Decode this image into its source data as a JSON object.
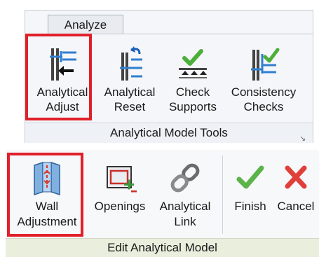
{
  "ribbon": {
    "tab": "Analyze",
    "top_panel": {
      "title": "Analytical Model Tools",
      "tools": [
        {
          "line1": "Analytical",
          "line2": "Adjust",
          "icon": "analytical-adjust-icon"
        },
        {
          "line1": "Analytical",
          "line2": "Reset",
          "icon": "analytical-reset-icon"
        },
        {
          "line1": "Check",
          "line2": "Supports",
          "icon": "check-supports-icon"
        },
        {
          "line1": "Consistency",
          "line2": "Checks",
          "icon": "consistency-checks-icon"
        }
      ]
    },
    "bottom_panel": {
      "title": "Edit Analytical Model",
      "tools": [
        {
          "line1": "Wall",
          "line2": "Adjustment",
          "icon": "wall-adjustment-icon"
        },
        {
          "line1": "Openings",
          "line2": "",
          "icon": "openings-icon"
        },
        {
          "line1": "Analytical",
          "line2": "Link",
          "icon": "analytical-link-icon"
        },
        {
          "line1": "Finish",
          "line2": "",
          "icon": "finish-checkmark-icon"
        },
        {
          "line1": "Cancel",
          "line2": "",
          "icon": "cancel-x-icon"
        }
      ]
    }
  },
  "colors": {
    "highlight": "#e0202a",
    "analytical_blue": "#2f7fd0",
    "check_green": "#4caf3a",
    "cancel_red": "#e0403a",
    "finish_green": "#5cb34a"
  }
}
